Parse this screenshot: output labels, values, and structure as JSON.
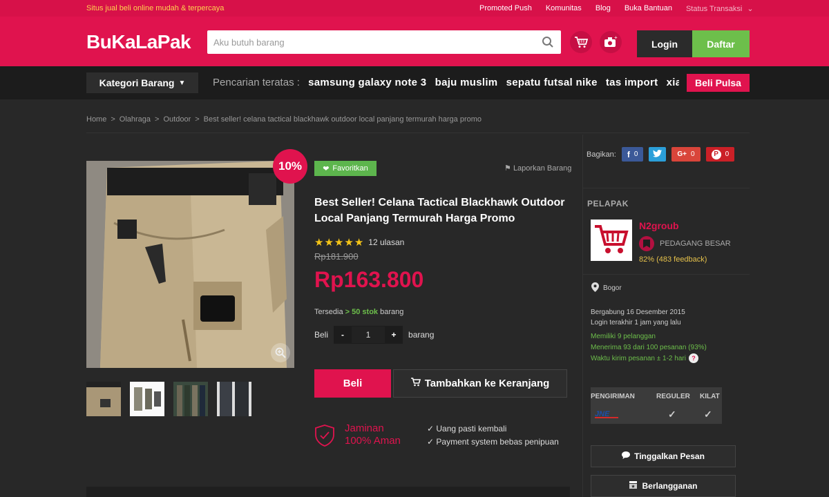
{
  "topbar": {
    "tagline": "Situs jual beli online mudah & terpercaya",
    "links": [
      "Promoted Push",
      "Komunitas",
      "Blog",
      "Buka Bantuan"
    ],
    "status": "Status Transaksi"
  },
  "header": {
    "logo": "BUKALAPAK",
    "search_placeholder": "Aku butuh barang",
    "login": "Login",
    "daftar": "Daftar",
    "icons": [
      "search-icon",
      "cart-list-icon",
      "camera-add-icon"
    ]
  },
  "nav": {
    "kategori": "Kategori Barang",
    "trending_label": "Pencarian teratas :",
    "trending": [
      "samsung galaxy note 3",
      "baju muslim",
      "sepatu futsal nike",
      "tas import",
      "xiaomi redmi"
    ],
    "beli_pulsa": "Beli Pulsa"
  },
  "breadcrumb": [
    "Home",
    "Olahraga",
    "Outdoor",
    "Best seller! celana tactical blackhawk outdoor local panjang termurah harga promo"
  ],
  "product": {
    "discount": "10%",
    "favorite": "Favoritkan",
    "report": "Laporkan Barang",
    "title": "Best Seller! Celana Tactical Blackhawk Outdoor Local Panjang Termurah Harga Promo",
    "rating": 5,
    "reviews": "12 ulasan",
    "old_price": "Rp181.900",
    "price": "Rp163.800",
    "stock_label": "Tersedia",
    "stock_value": "> 50 stok",
    "stock_unit": "barang",
    "qty_label": "Beli",
    "qty": "1",
    "qty_unit": "barang",
    "minus": "-",
    "plus": "+",
    "buy": "Beli",
    "add_to_cart": "Tambahkan ke Keranjang",
    "guarantee_title_1": "Jaminan",
    "guarantee_title_2": "100% Aman",
    "guarantee_1": "✓ Uang pasti kembali",
    "guarantee_2": "✓ Payment system bebas penipuan"
  },
  "share": {
    "label": "Bagikan:",
    "facebook": "0",
    "google": "0",
    "pinterest": "0",
    "colors": {
      "facebook": "#3b5998",
      "twitter": "#2b9fd9",
      "google": "#d9453a",
      "pinterest": "#cb2027"
    }
  },
  "seller": {
    "heading": "PELAPAK",
    "name": "N2groub",
    "badge": "PEDAGANG BESAR",
    "feedback": "82% (483 feedback)",
    "location": "Bogor",
    "joined": "Bergabung 16 Desember 2015",
    "last_login": "Login terakhir 1 jam yang lalu",
    "customers": "Memiliki 9 pelanggan",
    "accepted": "Menerima 93 dari 100 pesanan (93%)",
    "ship_time": "Waktu kirim pesanan ± 1-2 hari",
    "help": "?"
  },
  "shipping": {
    "headers": [
      "PENGIRIMAN",
      "REGULER",
      "KILAT"
    ],
    "courier": "JNE",
    "reguler": "✓",
    "kilat": "✓"
  },
  "actions": {
    "message": "Tinggalkan Pesan",
    "subscribe": "Berlangganan"
  },
  "colors": {
    "brand": "#e0134e",
    "green": "#6dbf4b",
    "bg": "#282828"
  }
}
